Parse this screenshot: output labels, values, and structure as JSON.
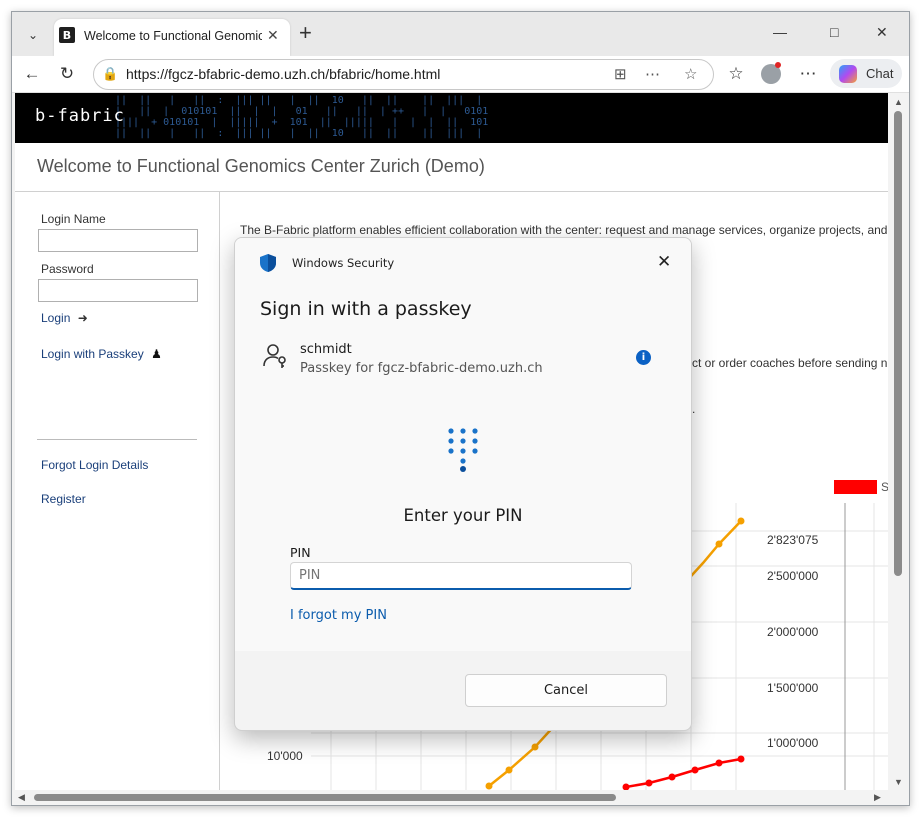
{
  "browser": {
    "tab_title": "Welcome to Functional Genomics",
    "tab_favicon_letter": "B",
    "url": "https://fgcz-bfabric-demo.uzh.ch/bfabric/home.html",
    "chat_label": "Chat",
    "accent_color": "#0b5cad"
  },
  "site": {
    "logo": "b-fabric",
    "deco_line1": "||  ||   |   ||  :  ||| ||   |  ||  10   ||  ||    ||  |||  |",
    "deco_line2": "|   ||  |  010101  ||  |  |   01   ||   ||  | ++   |  |   0101",
    "deco_line3": "||||  + 010101  |  |||||  +  101  ||  |||||   |  |  |  ||  101",
    "page_title": "Welcome to Functional Genomics Center Zurich (Demo)",
    "intro_text": "The B-Fabric platform enables efficient collaboration with the center: request and manage services, organize projects, and",
    "partial_text_1": "ct or order coaches before sending n",
    "partial_text_2": "."
  },
  "sidebar": {
    "login_name_label": "Login Name",
    "password_label": "Password",
    "login_link": "Login",
    "passkey_link": "Login with Passkey",
    "forgot_link": "Forgot Login Details",
    "register_link": "Register"
  },
  "chart_data": {
    "type": "line",
    "legend_partial": "S",
    "legend_color": "#ff0000",
    "right_axis_ticks": [
      "2'823'075",
      "2'500'000",
      "2'000'000",
      "1'500'000",
      "1'000'000"
    ],
    "left_axis_ticks": [
      "10'000"
    ],
    "series": [
      {
        "color": "#f5a000",
        "values_visible": "rising segment, ends at top of right axis (~2'823'075)"
      },
      {
        "color": "#ff0000",
        "values_visible": "rising segment near bottom"
      }
    ]
  },
  "dialog": {
    "app_name": "Windows Security",
    "heading": "Sign in with a passkey",
    "account_name": "schmidt",
    "account_desc": "Passkey for fgcz-bfabric-demo.uzh.ch",
    "info_glyph": "i",
    "pin_heading": "Enter your PIN",
    "pin_label": "PIN",
    "pin_placeholder": "PIN",
    "forgot_pin": "I forgot my PIN",
    "cancel_label": "Cancel"
  }
}
